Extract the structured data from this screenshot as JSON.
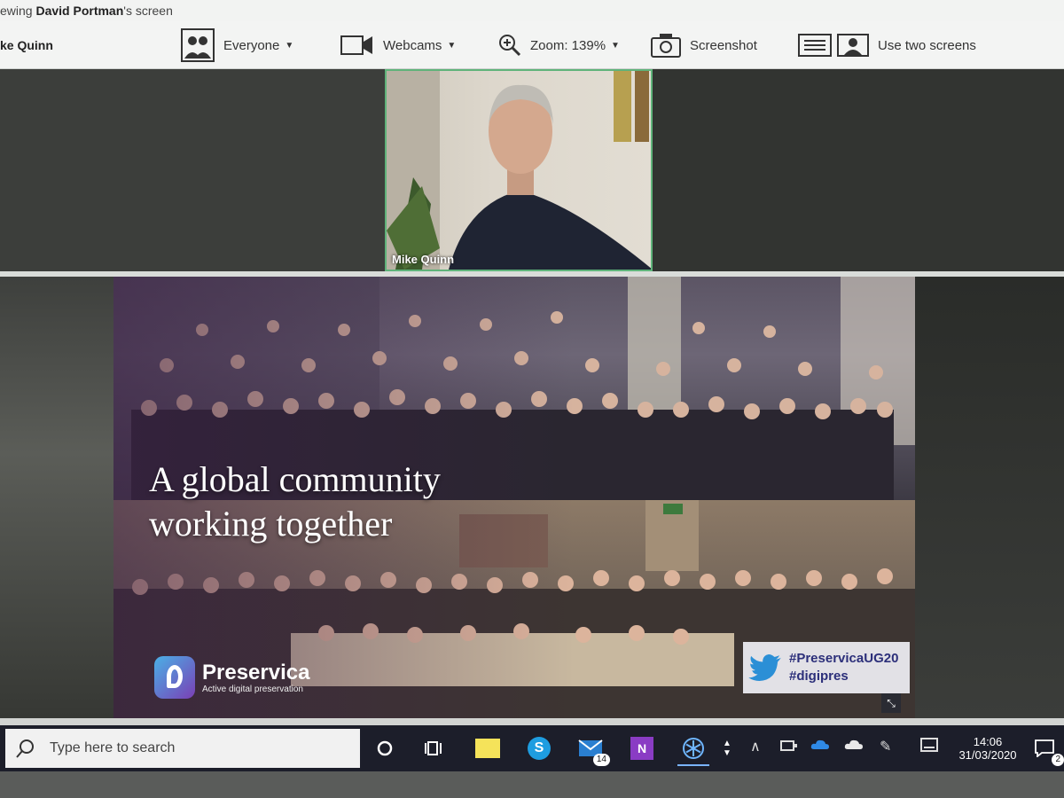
{
  "banner": {
    "prefix": "ewing ",
    "presenter": "David Portman",
    "suffix": "'s screen"
  },
  "toolbar": {
    "presenter_name": "ke Quinn",
    "everyone_label": "Everyone",
    "webcams_label": "Webcams",
    "zoom_label": "Zoom: 139%",
    "screenshot_label": "Screenshot",
    "two_screens_label": "Use two screens"
  },
  "webcam": {
    "participant_name": "Mike Quinn"
  },
  "slide": {
    "headline_line1": "A global community",
    "headline_line2": "working together",
    "brand_name": "Preservica",
    "brand_tagline": "Active digital preservation",
    "hashtags": [
      "#PreservicaUG20",
      "#digipres"
    ]
  },
  "taskbar": {
    "search_placeholder": "Type here to search",
    "mail_badge": "14",
    "notifications_badge": "2",
    "time": "14:06",
    "date": "31/03/2020"
  },
  "colors": {
    "accent": "#5fb37a",
    "taskbar": "#1c1e2a",
    "hashtag": "#2c2f7a"
  }
}
